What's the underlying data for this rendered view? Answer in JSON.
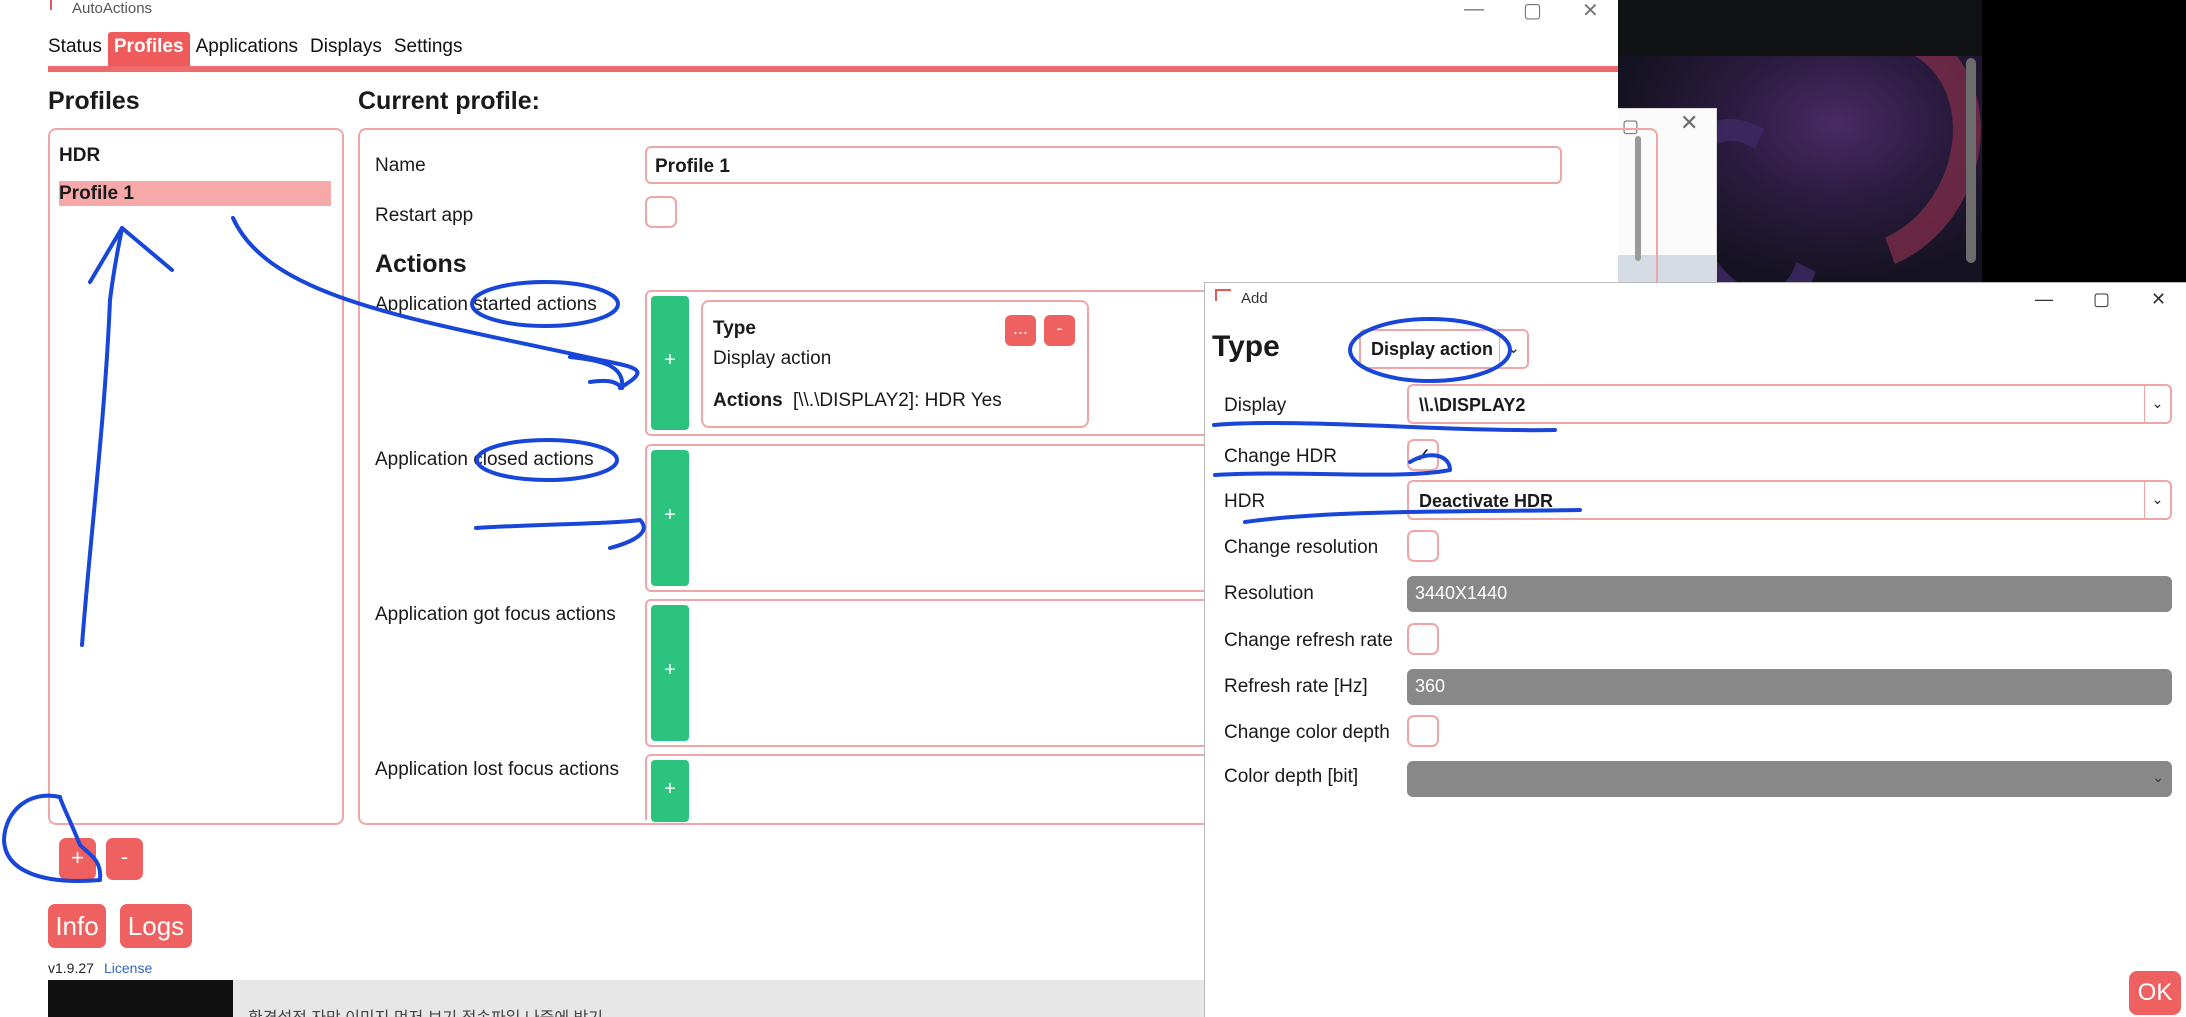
{
  "app": {
    "title": "AutoActions",
    "version": "v1.9.27",
    "license_link": "License"
  },
  "menu": [
    {
      "label": "Status"
    },
    {
      "label": "Profiles"
    },
    {
      "label": "Applications"
    },
    {
      "label": "Displays"
    },
    {
      "label": "Settings"
    }
  ],
  "profiles": {
    "heading": "Profiles",
    "items": [
      {
        "label": "HDR"
      },
      {
        "label": "Profile 1"
      }
    ],
    "selected": "Profile 1",
    "add_label": "+",
    "remove_label": "-"
  },
  "footer": {
    "info_label": "Info",
    "logs_label": "Logs"
  },
  "current_profile": {
    "heading": "Current profile:",
    "name_label": "Name",
    "name_value": "Profile 1",
    "restart_label": "Restart app",
    "actions_heading": "Actions",
    "groups": [
      {
        "label": "Application started actions"
      },
      {
        "label": "Application closed actions"
      },
      {
        "label": "Application got focus actions"
      },
      {
        "label": "Application lost focus actions"
      }
    ],
    "add_symbol": "+",
    "card": {
      "type_label": "Type",
      "type_value": "Display action",
      "actions_label": "Actions",
      "actions_value": "[\\\\.\\DISPLAY2]: HDR Yes",
      "edit_label": "...",
      "remove_label": "-"
    }
  },
  "dialog": {
    "title": "Add",
    "type_heading": "Type",
    "type_value": "Display action",
    "fields": {
      "display_label": "Display",
      "display_value": "\\\\.\\DISPLAY2",
      "change_hdr_label": "Change HDR",
      "change_hdr_checked": true,
      "hdr_label": "HDR",
      "hdr_value": "Deactivate HDR",
      "change_resolution_label": "Change resolution",
      "resolution_label": "Resolution",
      "resolution_value": "3440X1440",
      "change_refresh_label": "Change refresh rate",
      "refresh_label": "Refresh rate [Hz]",
      "refresh_value": "360",
      "change_color_depth_label": "Change color depth",
      "color_depth_label": "Color depth [bit]",
      "color_depth_value": ""
    },
    "ok_label": "OK"
  },
  "background": {
    "taskbar_text": "환경설정   자막   이미지 먼저 보기   접속파일 나중에 받기"
  },
  "colors": {
    "accent": "#ef5a5a",
    "border": "#f0a6a6",
    "add_green": "#2bc37d",
    "annotation": "#1746d8"
  }
}
